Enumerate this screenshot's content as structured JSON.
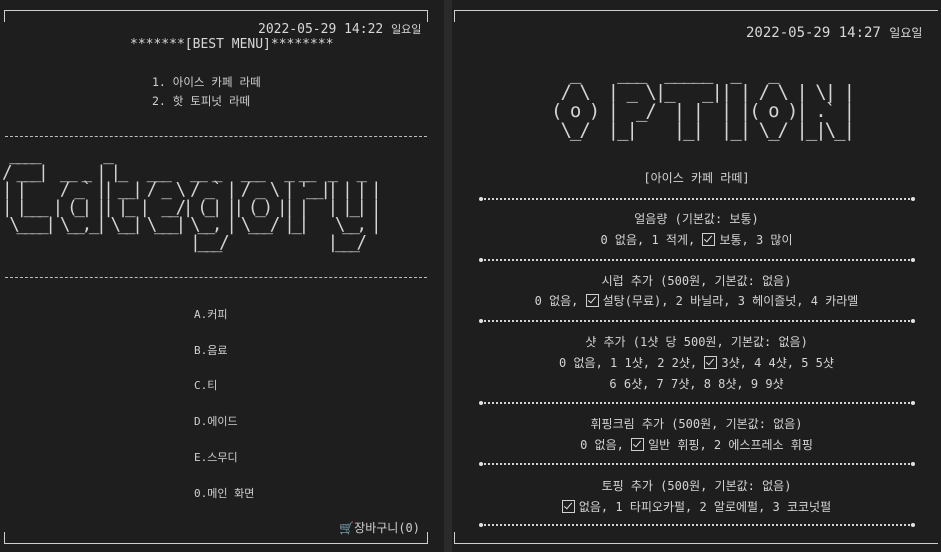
{
  "left": {
    "timestamp": "2022-05-29 14:22",
    "weekday": "일요일",
    "best_menu_title": "*******[BEST MENU]********",
    "best_items": [
      "1. 아이스 카페 라떼",
      "2. 핫 토피넛 라떼"
    ],
    "ascii_category": " ____         _\n/ ___|  __ _ | |_   ___   __ _   ___   _ __  _   _\n| |     / _` || __| / _ \\ / _` | / _ \\ | '__|| | | |\n| |___ | (_| || |_ |  __/| (_| || (_) || |   | |_| |\n \\____| \\__,_| \\__| \\___| \\__, | \\___/ |_|    \\__, |\n                          |___/              |___/",
    "categories": [
      "A.커피",
      "B.음료",
      "C.티",
      "D.에이드",
      "E.스무디",
      "0.메인 화면"
    ],
    "cart_label": "장바구니(0)"
  },
  "right": {
    "timestamp": "2022-05-29 14:27",
    "weekday": "일요일",
    "ascii_option": "  _    ___  _____  _   _\n / \\  | _ \\|_   _|| | / \\ | \\| |\n( o ) |  _/  | |  | |( o )| .` |\n \\_/  |_|    |_|  |_| \\_/ |_|\\_|",
    "item_name": "[아이스 카페 라떼]",
    "sections": [
      {
        "title": "얼음량 (기본값: 보통)",
        "lines": [
          [
            {
              "t": "0 없음, 1 적게, "
            },
            {
              "c": true,
              "t": "보통, 3 많이"
            }
          ]
        ]
      },
      {
        "title": "시럽 추가 (500원, 기본값: 없음)",
        "lines": [
          [
            {
              "t": "0 없음, "
            },
            {
              "c": true,
              "t": "설탕(무료), 2 바닐라, 3 헤이즐넛, 4 카라멜"
            }
          ]
        ]
      },
      {
        "title": "샷 추가 (1샷 당 500원, 기본값: 없음)",
        "lines": [
          [
            {
              "t": "0 없음, 1 1샷, 2 2샷, "
            },
            {
              "c": true,
              "t": "3샷, 4 4샷, 5 5샷"
            }
          ],
          [
            {
              "t": "6 6샷, 7 7샷, 8 8샷, 9 9샷"
            }
          ]
        ]
      },
      {
        "title": "휘핑크림 추가 (500원, 기본값: 없음)",
        "lines": [
          [
            {
              "t": "0 없음, "
            },
            {
              "c": true,
              "t": "일반 휘핑, 2 에스프레소 휘핑"
            }
          ]
        ]
      },
      {
        "title": "토핑 추가 (500원, 기본값: 없음)",
        "lines": [
          [
            {
              "c": true,
              "t": "없음, 1 타피오카펄, 2 알로에펄, 3 코코넛펄"
            }
          ]
        ]
      }
    ]
  },
  "colors": {
    "background": "#1e1e1e",
    "text": "#cccccc",
    "frame": "#cfcfcf"
  }
}
